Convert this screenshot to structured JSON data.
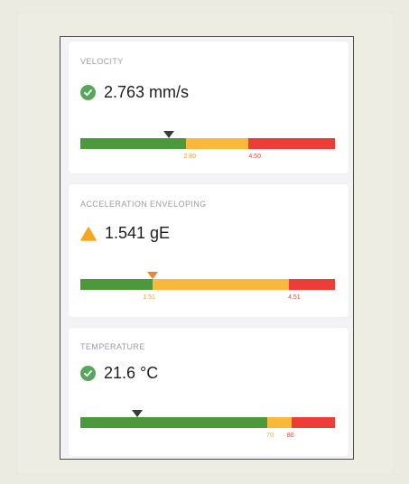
{
  "cards": [
    {
      "title": "VELOCITY",
      "status_icon": "check-circle-icon",
      "value": "2.763 mm/s",
      "gauge": {
        "green_end": 0.414,
        "yellow_end": 0.66,
        "marker": 0.347,
        "marker_color": "#3a3a3a",
        "thresholds": [
          {
            "label": "2.80",
            "position": 0.43,
            "color": "yellow"
          },
          {
            "label": "4.50",
            "position": 0.685,
            "color": "red"
          }
        ]
      }
    },
    {
      "title": "ACCELERATION ENVELOPING",
      "status_icon": "warning-triangle-icon",
      "value": "1.541 gE",
      "gauge": {
        "green_end": 0.285,
        "yellow_end": 0.82,
        "marker": 0.285,
        "marker_color": "#f5822a",
        "thresholds": [
          {
            "label": "1.51",
            "position": 0.27,
            "color": "yellow"
          },
          {
            "label": "4.51",
            "position": 0.84,
            "color": "red"
          }
        ]
      }
    },
    {
      "title": "TEMPERATURE",
      "status_icon": "check-circle-icon",
      "value": "21.6 °C",
      "gauge": {
        "green_end": 0.735,
        "yellow_end": 0.83,
        "marker": 0.222,
        "marker_color": "#3a3a3a",
        "thresholds": [
          {
            "label": "70",
            "position": 0.745,
            "color": "yellow"
          },
          {
            "label": "80",
            "position": 0.825,
            "color": "red"
          }
        ]
      }
    }
  ]
}
